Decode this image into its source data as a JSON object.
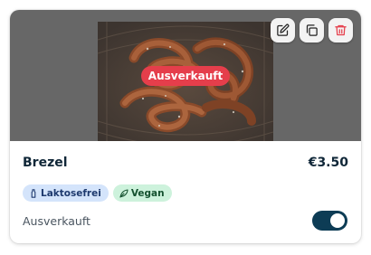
{
  "product": {
    "name": "Brezel",
    "price": "€3.50",
    "image_alt": "Brezel",
    "overlay_badge": "Ausverkauft",
    "tags": [
      {
        "label": "Laktosefrei",
        "icon": "bottle-icon",
        "color": "#d4e4fb"
      },
      {
        "label": "Vegan",
        "icon": "leaf-icon",
        "color": "#cdf2dc"
      }
    ],
    "status_label": "Ausverkauft",
    "sold_out_toggle_on": true
  },
  "actions": {
    "edit_icon": "edit-icon",
    "duplicate_icon": "copy-icon",
    "delete_icon": "trash-icon"
  },
  "colors": {
    "badge": "#e53e4b",
    "toggle": "#0d3c55",
    "text": "#102738",
    "delete": "#e53e4b"
  }
}
